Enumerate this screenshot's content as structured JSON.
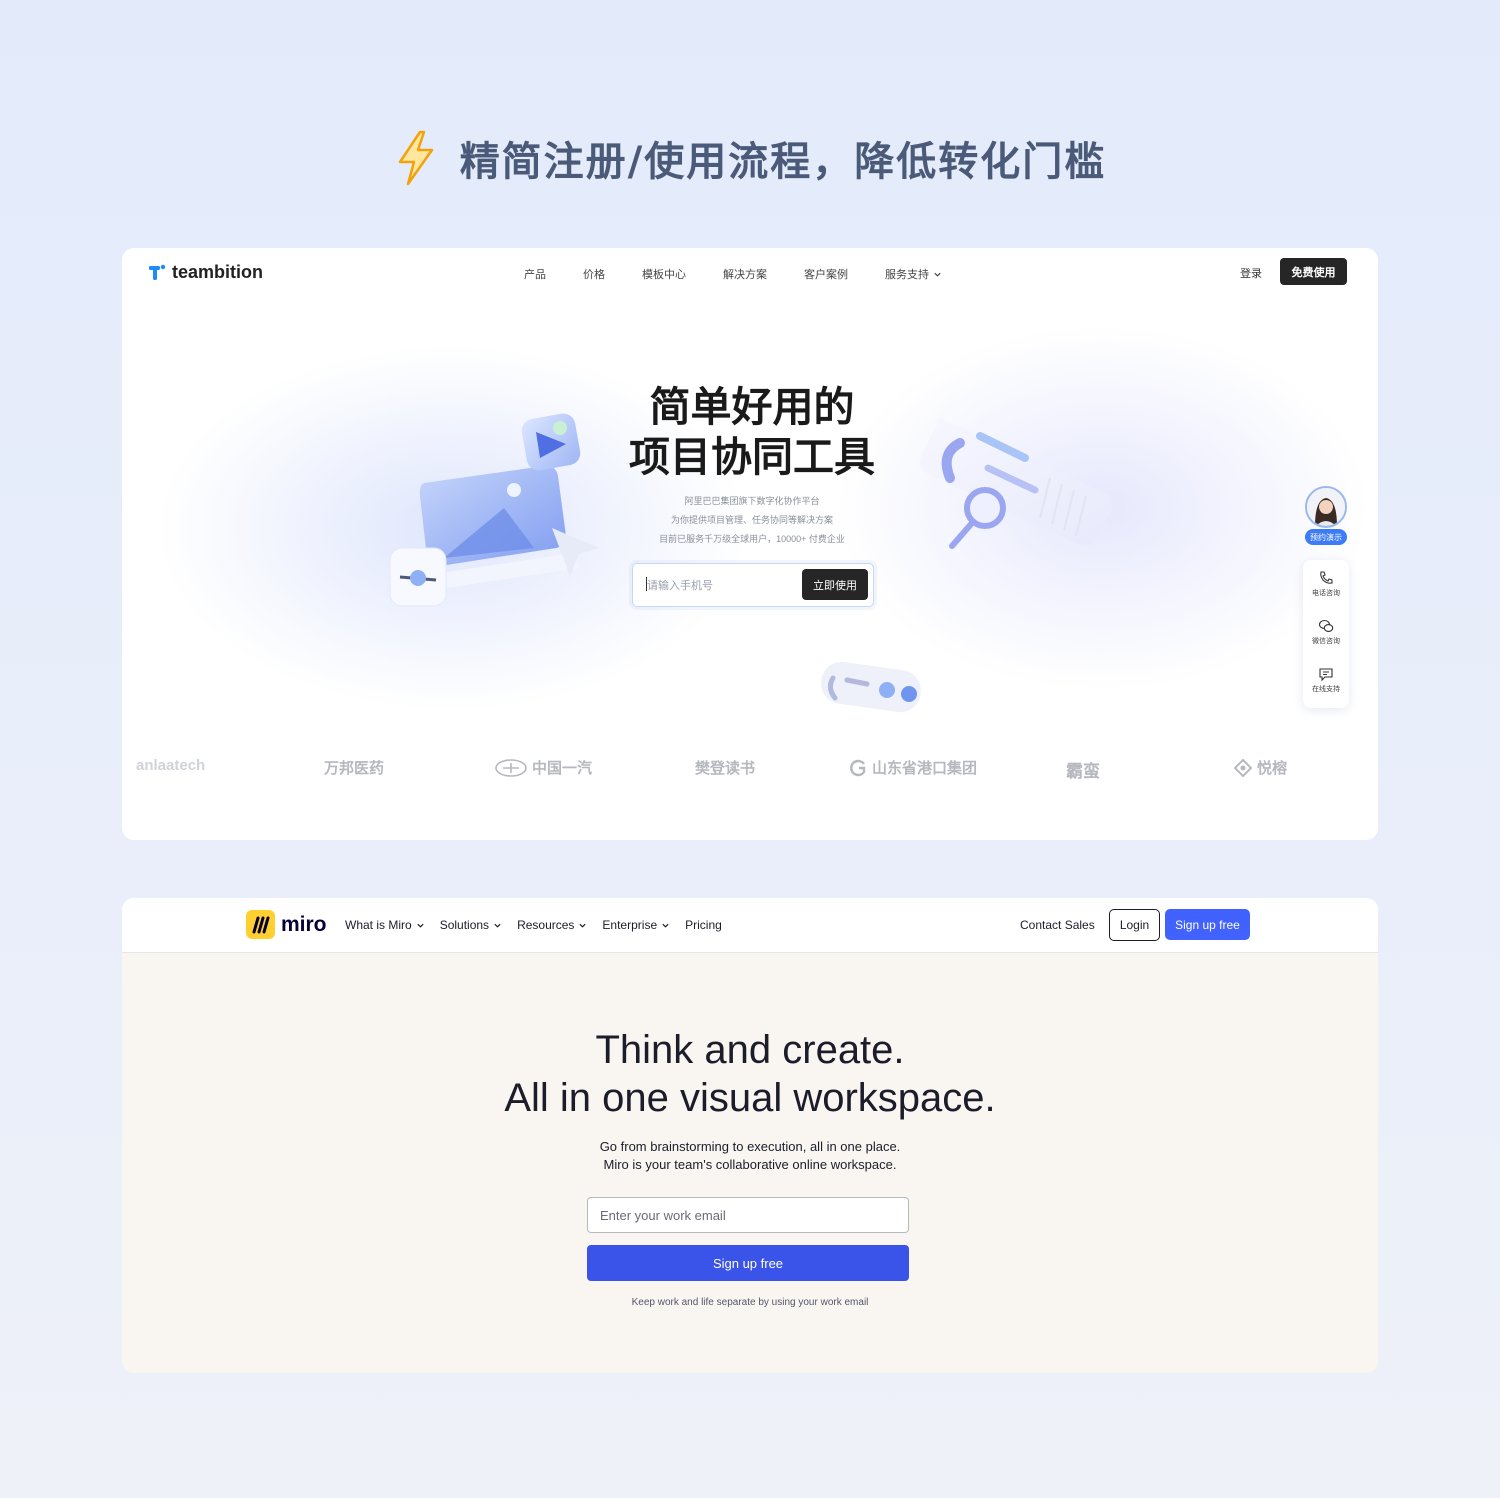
{
  "headline": {
    "icon": "lightning-bolt-icon",
    "text": "精简注册/使用流程，降低转化门槛"
  },
  "teambition": {
    "logo_text": "teambition",
    "nav": [
      "产品",
      "价格",
      "模板中心",
      "解决方案",
      "客户案例",
      "服务支持"
    ],
    "login": "登录",
    "cta": "免费使用",
    "hero_title_line1": "简单好用的",
    "hero_title_line2": "项目协同工具",
    "subtitle_lines": [
      "阿里巴巴集团旗下数字化协作平台",
      "为你提供项目管理、任务协同等解决方案",
      "目前已服务千万级全球用户，10000+ 付费企业"
    ],
    "phone_placeholder": "请输入手机号",
    "submit": "立即使用",
    "clients": [
      "anlaatech",
      "万邦医药",
      "中国一汽",
      "樊登读书",
      "山东省港口集团",
      "霸蛮",
      "悦榕"
    ],
    "side": {
      "demo": "预约演示",
      "items": [
        {
          "icon": "phone-icon",
          "label": "电话咨询"
        },
        {
          "icon": "wechat-icon",
          "label": "微信咨询"
        },
        {
          "icon": "chat-icon",
          "label": "在线支持"
        }
      ]
    },
    "accent": "#1d8cf8"
  },
  "miro": {
    "logo_text": "miro",
    "nav": [
      "What is Miro",
      "Solutions",
      "Resources",
      "Enterprise",
      "Pricing"
    ],
    "contact_sales": "Contact Sales",
    "login": "Login",
    "signup_top": "Sign up free",
    "hero_line1": "Think and create.",
    "hero_line2": "All in one visual workspace.",
    "sub_line1": "Go from brainstorming to execution, all in one place.",
    "sub_line2": "Miro is your team's collaborative online workspace.",
    "email_placeholder": "Enter your work email",
    "signup": "Sign up free",
    "note": "Keep work and life separate by using your work email",
    "brand_yellow": "#ffd02f",
    "brand_blue": "#4262ff"
  }
}
